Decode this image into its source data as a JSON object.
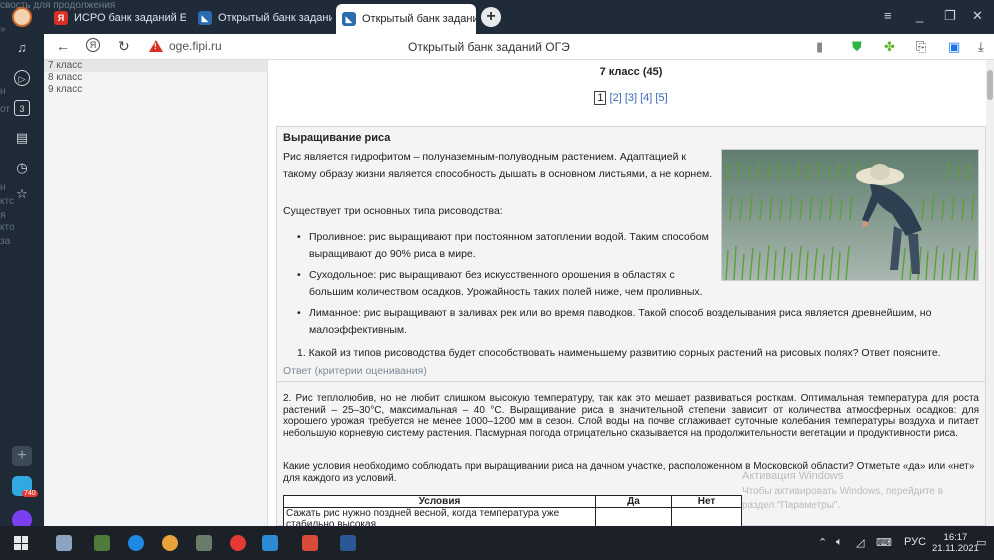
{
  "window": {
    "overflow_text_top": "свость для продолжения",
    "overflow_side": [
      "»",
      "н",
      "от",
      "н",
      "ктс",
      "я",
      "кто",
      "за"
    ]
  },
  "tabs": [
    {
      "label": "ИСРО банк заданий ЕНГ",
      "active": false,
      "favicon_color": "#d93025"
    },
    {
      "label": "Открытый банк заданий д",
      "active": false,
      "favicon_color": "#2b6cb0"
    },
    {
      "label": "Открытый банк задани",
      "active": true,
      "favicon_color": "#2b6cb0"
    }
  ],
  "addressbar": {
    "domain": "oge.fipi.ru",
    "page_title": "Открытый банк заданий ОГЭ"
  },
  "sidebar": {
    "items": [
      "7 класс",
      "8 класс",
      "9 класс"
    ],
    "selected_index": 0
  },
  "main": {
    "grade_title": "7 класс (45)",
    "pages": [
      "1",
      "[2]",
      "[3]",
      "[4]",
      "[5]"
    ],
    "current_page": "1",
    "task": {
      "heading": "Выращивание риса",
      "intro_line1": "Рис является гидрофитом – полуназемным-полуводным растением. Адаптацией к",
      "intro_line2": "такому образу жизни является способность дышать в основном листьями, а не корнем.",
      "types_intro": "Существует три основных типа рисоводства:",
      "types": [
        "Проливное: рис выращивают при постоянном затоплении водой. Таким способом выращивают до 90% риса в мире.",
        "Суходольное: рис выращивают без искусственного орошения в областях с большим количеством осадков. Урожайность таких полей ниже, чем проливных.",
        "Лиманное: рис выращивают в заливах рек или во время паводков. Такой способ возделывания риса является древнейшим, но малоэффективным."
      ],
      "question1": "1. Какой из типов рисоводства будет способствовать наименьшему развитию сорных растений на рисовых полях? Ответ поясните.",
      "answer_link": "Ответ (критерии оценивания)",
      "text2": "2. Рис теплолюбив, но не любит слишком высокую температуру, так как это мешает развиваться росткам. Оптимальная температура для роста растений – 25–30°С, максимальная – 40 °С. Выращивание риса в значительной степени зависит от количества атмосферных осадков: для хорошего урожая требуется не менее 1000–1200 мм в сезон. Слой воды на почве сглаживает суточные колебания температуры воздуха и питает небольшую корневую систему растения. Пасмурная погода отрицательно сказывается на продолжительности вегетации и продуктивности риса.",
      "question2": "Какие условия необходимо соблюдать при выращивании риса на дачном участке, расположенном в Московской области? Отметьте «да» или «нет» для каждого из условий.",
      "table": {
        "headers": [
          "Условия",
          "Да",
          "Нет"
        ],
        "rows": [
          [
            "Сажать рис нужно поздней весной, когда температура уже стабильно высокая",
            "",
            ""
          ]
        ]
      }
    }
  },
  "activation": {
    "line1": "Активация Windows",
    "line2": "Чтобы активировать Windows, перейдите в",
    "line3": "раздел \"Параметры\"."
  },
  "taskbar": {
    "lang": "РУС",
    "time": "16:17",
    "date": "21.11.2021",
    "rail_badge": "740"
  },
  "colors": {
    "accent_link": "#3a6ab8",
    "chrome_dark": "#1f2b38",
    "warning": "#d93025"
  }
}
